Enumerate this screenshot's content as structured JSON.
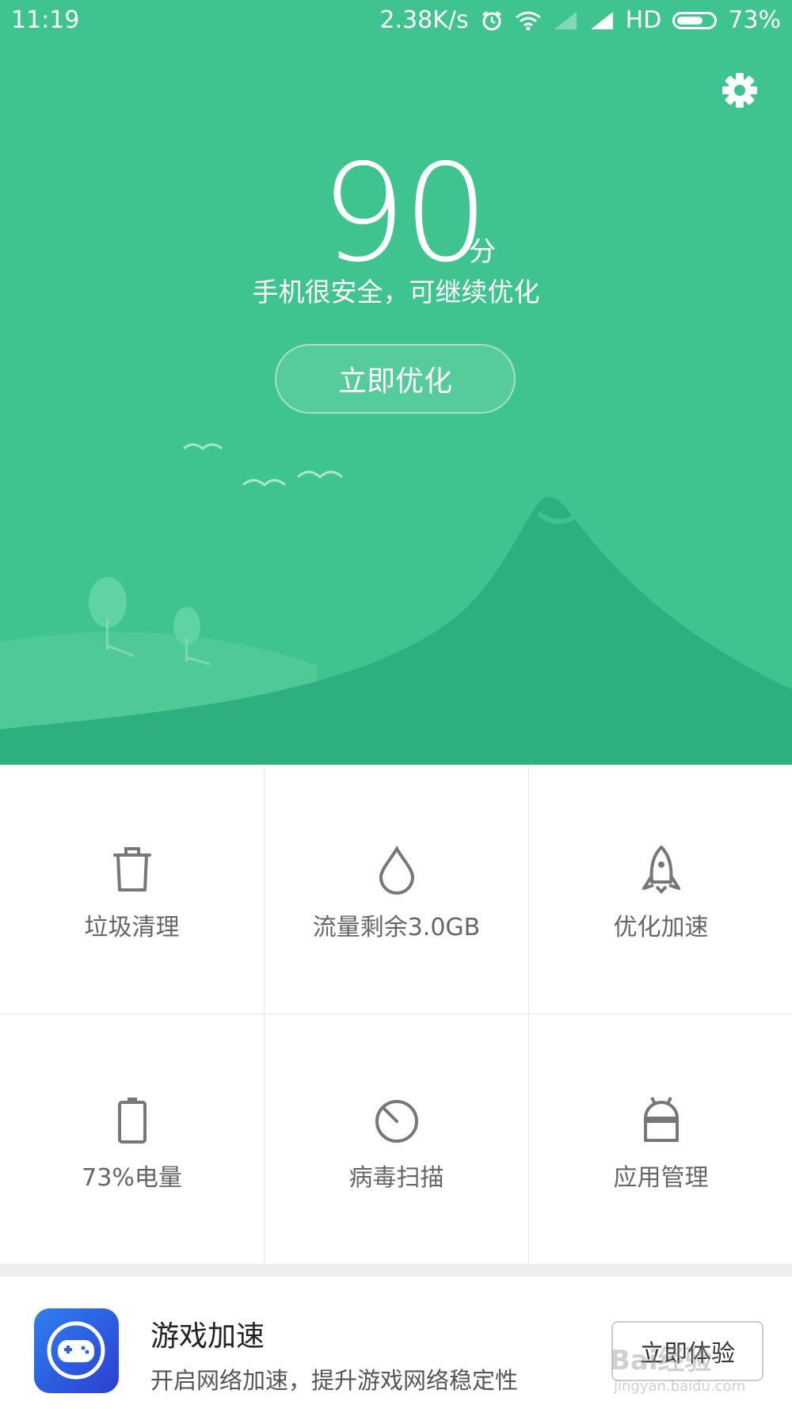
{
  "status_bar": {
    "time": "11:19",
    "net_speed": "2.38K/s",
    "hd": "HD",
    "battery_percent": "73%",
    "battery_level": 0.73
  },
  "header": {
    "settings_icon": "gear-icon"
  },
  "score": {
    "value": "90",
    "unit": "分",
    "message": "手机很安全，可继续优化",
    "button_label": "立即优化"
  },
  "grid": {
    "items": [
      {
        "label": "垃圾清理",
        "icon": "trash-icon"
      },
      {
        "label": "流量剩余3.0GB",
        "icon": "drop-icon"
      },
      {
        "label": "优化加速",
        "icon": "rocket-icon"
      },
      {
        "label": "73%电量",
        "icon": "battery-icon"
      },
      {
        "label": "病毒扫描",
        "icon": "scan-icon"
      },
      {
        "label": "应用管理",
        "icon": "android-icon"
      }
    ]
  },
  "promo": {
    "title": "游戏加速",
    "subtitle": "开启网络加速，提升游戏网络稳定性",
    "button_label": "立即体验",
    "icon": "gamepad-icon"
  },
  "watermark": {
    "text": "Bai经验",
    "url_text": "jingyan.baidu.com"
  },
  "colors": {
    "accent": "#3fc48f",
    "hill_dark": "#2eaf7f"
  }
}
